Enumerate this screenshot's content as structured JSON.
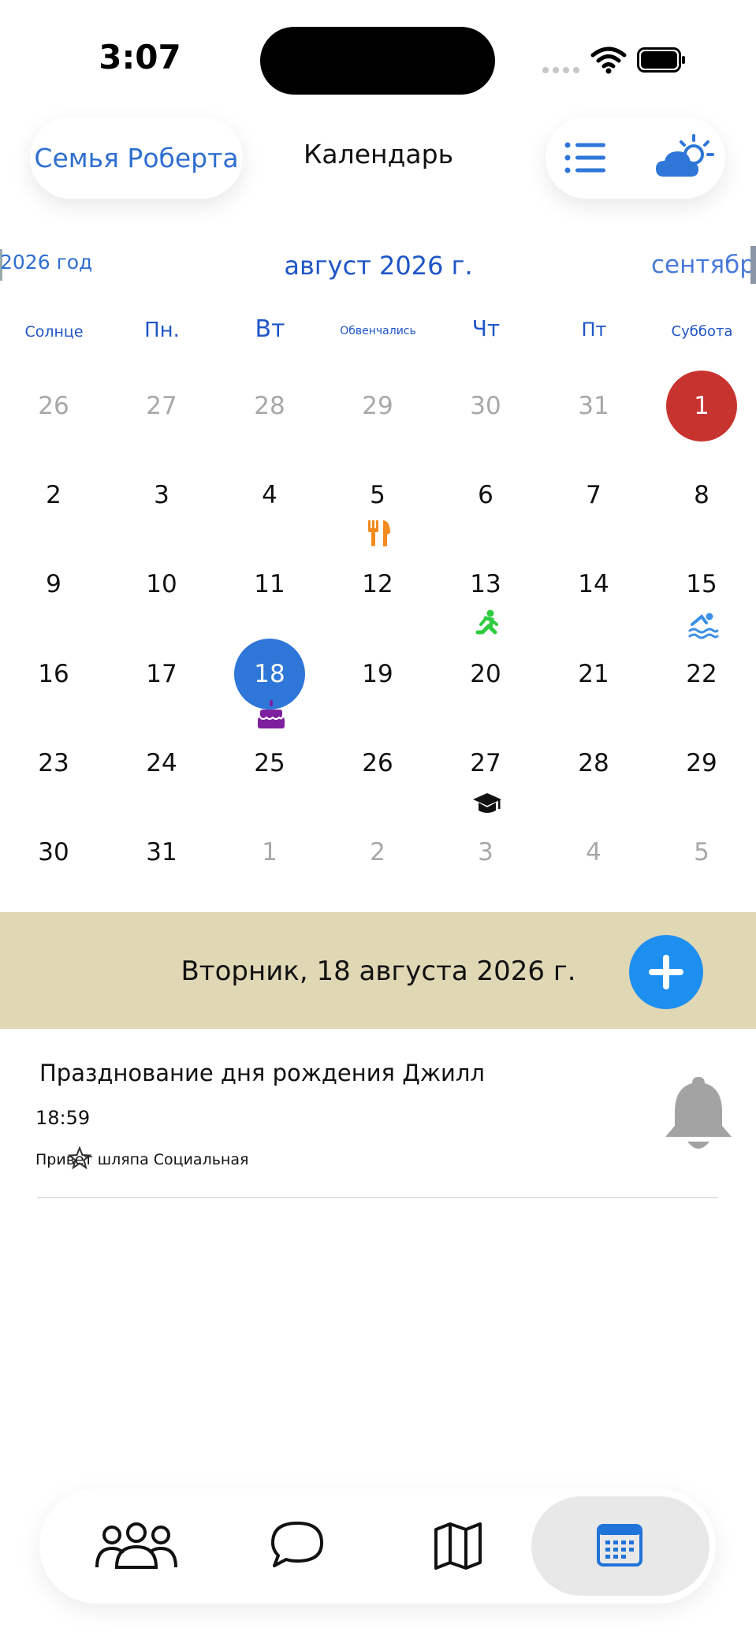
{
  "status": {
    "time": "3:07"
  },
  "header": {
    "family_button": "Семья Роберта",
    "title": "Календарь",
    "icons": {
      "list": "list-icon",
      "weather": "partly-cloudy-icon"
    }
  },
  "month_nav": {
    "prev": "2026 год",
    "current": "август 2026 г.",
    "next": "сентябрь"
  },
  "weekdays": [
    "Солнце",
    "Пн.",
    "Вт",
    "Обвенчались",
    "Чт",
    "Пт",
    "Суббота"
  ],
  "calendar": {
    "weeks": [
      [
        "26",
        "27",
        "28",
        "29",
        "30",
        "31",
        "1"
      ],
      [
        "2",
        "3",
        "4",
        "5",
        "6",
        "7",
        "8"
      ],
      [
        "9",
        "10",
        "11",
        "12",
        "13",
        "14",
        "15"
      ],
      [
        "16",
        "17",
        "18",
        "19",
        "20",
        "21",
        "22"
      ],
      [
        "23",
        "24",
        "25",
        "26",
        "27",
        "28",
        "29"
      ],
      [
        "30",
        "31",
        "1",
        "2",
        "3",
        "4",
        "5"
      ]
    ],
    "today_color": "#c7342f",
    "selected_color": "#2e77d9",
    "event_icons": [
      {
        "day": "5",
        "icon": "fork-knife-icon",
        "color": "#f28a1e"
      },
      {
        "day": "13",
        "icon": "running-person-icon",
        "color": "#2ecc3f"
      },
      {
        "day": "15",
        "icon": "swimming-icon",
        "color": "#3b8fe6"
      },
      {
        "day": "18",
        "icon": "birthday-cake-icon",
        "color": "#7d1f9e"
      },
      {
        "day": "27",
        "icon": "graduation-cap-icon",
        "color": "#111111"
      }
    ]
  },
  "selected_date": {
    "label": "Вторник, 18 августа 2026 г.",
    "bar_color": "#e0d7b5"
  },
  "events": [
    {
      "title": "Празднование дня рождения Джилл",
      "time": "18:59",
      "description": "Привет шляпа Социальная"
    }
  ],
  "bottom_nav": {
    "items": [
      "people-icon",
      "chat-bubble-icon",
      "map-icon",
      "calendar-icon"
    ],
    "active": "calendar-icon"
  },
  "accent": "#1d8ff0"
}
